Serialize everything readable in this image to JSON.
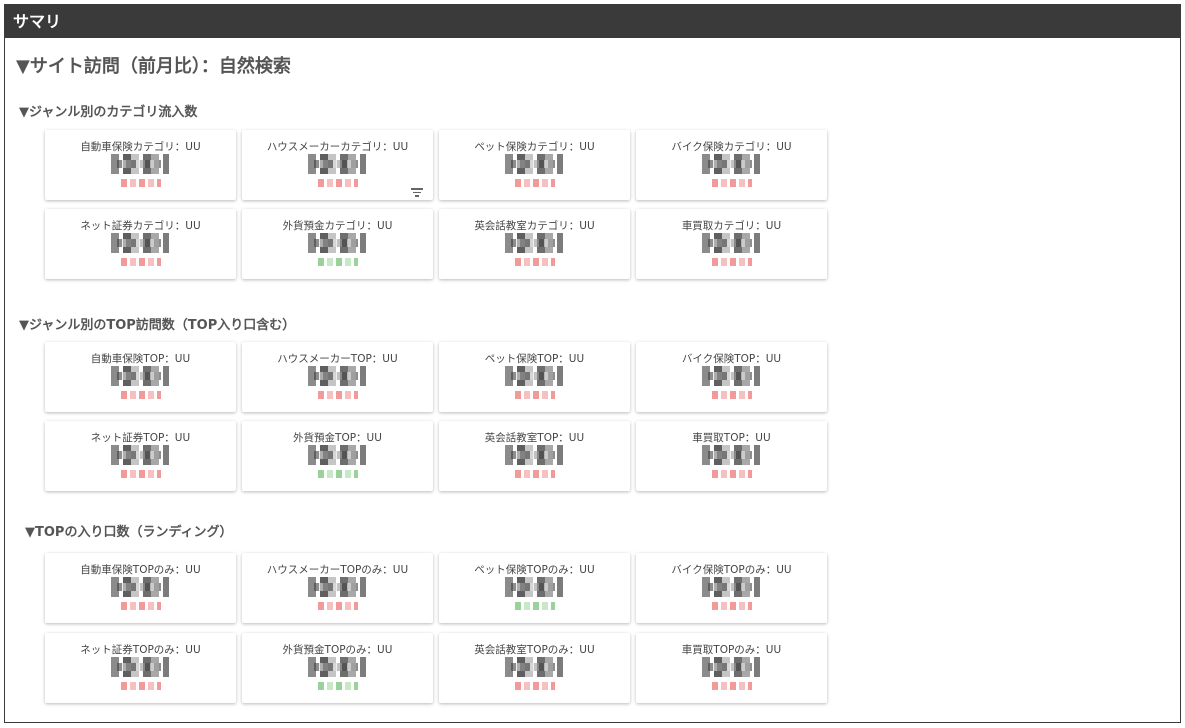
{
  "header": {
    "title": "サマリ"
  },
  "page": {
    "title": "▼サイト訪問（前月比）：自然検索"
  },
  "sections": [
    {
      "title": "▼ジャンル別のカテゴリ流入数",
      "cards": [
        {
          "label": "自動車保険カテゴリ：UU",
          "delta_color": "red"
        },
        {
          "label": "ハウスメーカーカテゴリ：UU",
          "delta_color": "red",
          "has_filter_icon": true
        },
        {
          "label": "ペット保険カテゴリ：UU",
          "delta_color": "red"
        },
        {
          "label": "バイク保険カテゴリ：UU",
          "delta_color": "red"
        },
        {
          "label": "ネット証券カテゴリ：UU",
          "delta_color": "red"
        },
        {
          "label": "外貨預金カテゴリ：UU",
          "delta_color": "green"
        },
        {
          "label": "英会話教室カテゴリ：UU",
          "delta_color": "red"
        },
        {
          "label": "車買取カテゴリ：UU",
          "delta_color": "red"
        }
      ]
    },
    {
      "title": "▼ジャンル別のTOP訪問数（TOP入り口含む）",
      "cards": [
        {
          "label": "自動車保険TOP：UU",
          "delta_color": "red"
        },
        {
          "label": "ハウスメーカーTOP：UU",
          "delta_color": "red"
        },
        {
          "label": "ペット保険TOP：UU",
          "delta_color": "red"
        },
        {
          "label": "バイク保険TOP：UU",
          "delta_color": "red"
        },
        {
          "label": "ネット証券TOP：UU",
          "delta_color": "red"
        },
        {
          "label": "外貨預金TOP：UU",
          "delta_color": "green"
        },
        {
          "label": "英会話教室TOP：UU",
          "delta_color": "red"
        },
        {
          "label": "車買取TOP：UU",
          "delta_color": "red"
        }
      ]
    },
    {
      "title": "▼TOPの入り口数（ランディング）",
      "cards": [
        {
          "label": "自動車保険TOPのみ：UU",
          "delta_color": "red"
        },
        {
          "label": "ハウスメーカーTOPのみ：UU",
          "delta_color": "red"
        },
        {
          "label": "ペット保険TOPのみ：UU",
          "delta_color": "green"
        },
        {
          "label": "バイク保険TOPのみ：UU",
          "delta_color": "red"
        },
        {
          "label": "ネット証券TOPのみ：UU",
          "delta_color": "red"
        },
        {
          "label": "外貨預金TOPのみ：UU",
          "delta_color": "green"
        },
        {
          "label": "英会話教室TOPのみ：UU",
          "delta_color": "red"
        },
        {
          "label": "車買取TOPのみ：UU",
          "delta_color": "red"
        }
      ]
    }
  ],
  "colors": {
    "header_bg": "#3a3a3a",
    "delta_red": "#f29a9a",
    "delta_green": "#9bd29b"
  },
  "icons": {
    "filter": "filter-icon"
  }
}
